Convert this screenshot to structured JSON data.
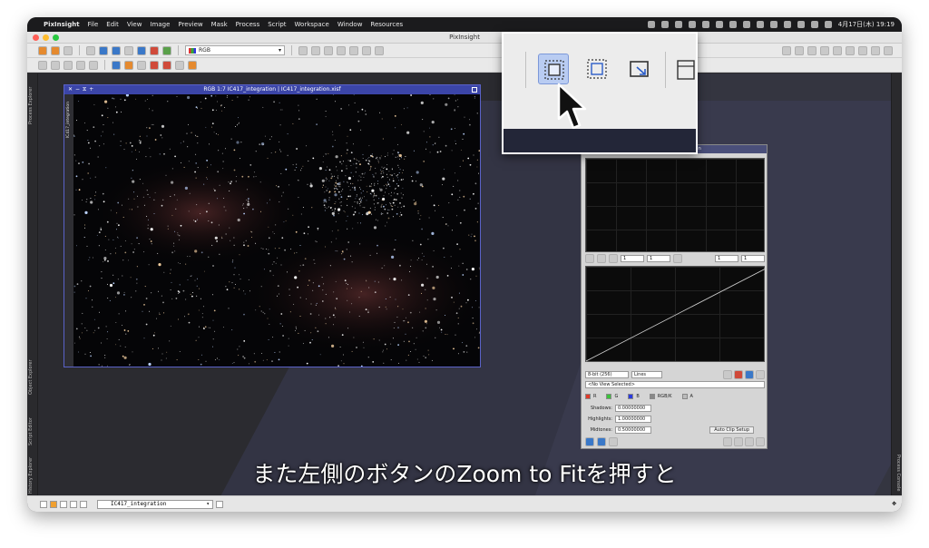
{
  "menubar": {
    "apple": "",
    "items": [
      "PixInsight",
      "File",
      "Edit",
      "View",
      "Image",
      "Preview",
      "Mask",
      "Process",
      "Script",
      "Workspace",
      "Window",
      "Resources"
    ],
    "datetime": "4月17日(木) 19:19"
  },
  "window": {
    "title": "PixInsight"
  },
  "toolbar": {
    "rgb_select": "RGB"
  },
  "left_tabs": [
    "Process Explorer",
    "Object Explorer",
    "Script Editor",
    "History Explorer"
  ],
  "right_tabs": [
    "Process Console"
  ],
  "image_window": {
    "title": "RGB 1:7 IC417_integration | IC417_integration.xisf",
    "side_label": "IC417_integration"
  },
  "histogram": {
    "title": "ation",
    "spin_values": [
      "1",
      "1",
      "1",
      "1"
    ],
    "resolution": "8-bit (256)",
    "graph_style": "Lines",
    "view_select": "<No View Selected>",
    "channels": [
      {
        "label": "R",
        "color": "#e03a2a"
      },
      {
        "label": "G",
        "color": "#3cc23c"
      },
      {
        "label": "B",
        "color": "#2a3ae0"
      },
      {
        "label": "RGB/K",
        "color": "#888888"
      },
      {
        "label": "A",
        "color": "#bbbbbb"
      }
    ],
    "shadows_label": "Shadows:",
    "shadows": "0.00000000",
    "highlights_label": "Highlights:",
    "highlights": "1.00000000",
    "midtones_label": "Midtones:",
    "midtones": "0.50000000",
    "auto_clip": "Auto Clip Setup"
  },
  "caption": "また左側のボタンのZoom to Fitを押すと",
  "statusbar": {
    "view": "IC417_integration"
  }
}
